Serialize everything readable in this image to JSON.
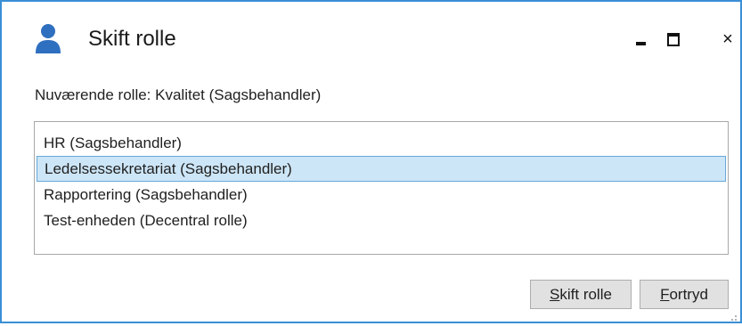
{
  "window": {
    "title": "Skift rolle",
    "icon": "user-icon",
    "controls": {
      "minimize": "minimize-icon",
      "maximize": "maximize-icon",
      "close": "×"
    }
  },
  "current_role_text": "Nuværende rolle: Kvalitet (Sagsbehandler)",
  "roles": {
    "items": [
      {
        "label": "HR (Sagsbehandler)",
        "selected": false
      },
      {
        "label": "Ledelsessekretariat (Sagsbehandler)",
        "selected": true
      },
      {
        "label": "Rapportering (Sagsbehandler)",
        "selected": false
      },
      {
        "label": "Test-enheden (Decentral rolle)",
        "selected": false
      }
    ]
  },
  "buttons": {
    "switch_label": "Skift rolle",
    "cancel_label": "Fortryd"
  },
  "colors": {
    "accent_border": "#3a8fd6",
    "selection_bg": "#cde6f7",
    "selection_border": "#66a7d8",
    "user_icon": "#2f6fc0"
  }
}
